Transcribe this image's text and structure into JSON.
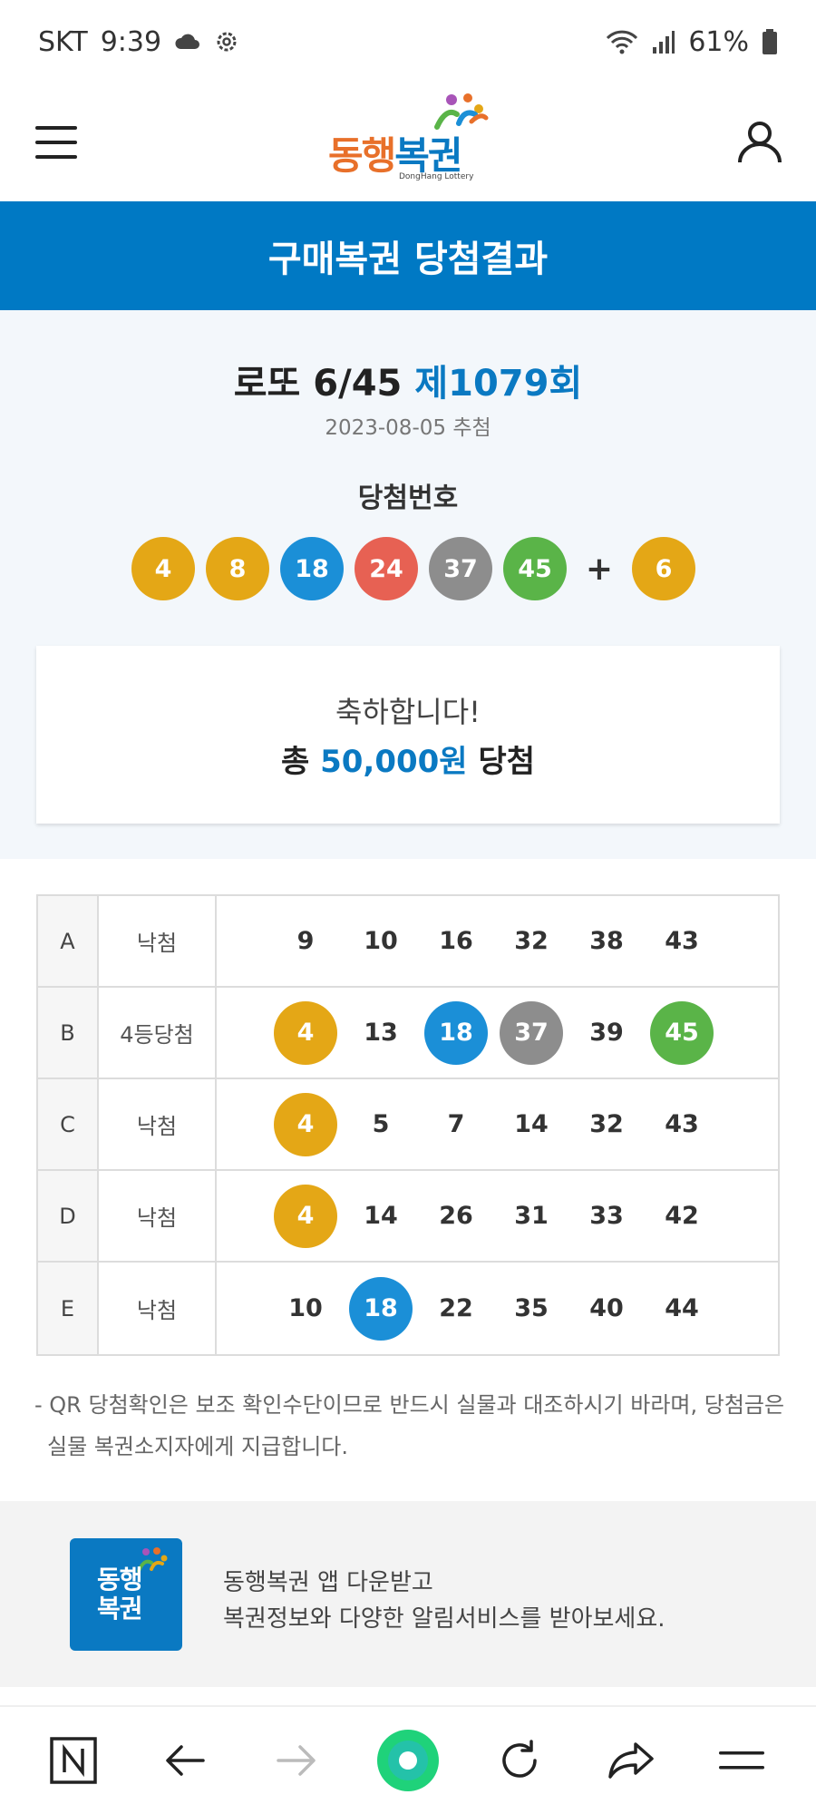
{
  "status_bar": {
    "carrier": "SKT",
    "time": "9:39",
    "battery": "61%",
    "icons": [
      "cloud-icon",
      "settings-icon",
      "wifi-icon",
      "signal-icon",
      "battery-icon"
    ]
  },
  "header": {
    "logo_text_part1": "동행",
    "logo_text_part2": "복권",
    "logo_sub": "DongHang Lottery",
    "menu_icon": "hamburger-menu-icon",
    "user_icon": "user-icon"
  },
  "banner": {
    "title": "구매복권 당첨결과"
  },
  "draw": {
    "game": "로또 6/45",
    "round": "제1079회",
    "date": "2023-08-05 추첨",
    "win_label": "당첨번호",
    "numbers": [
      {
        "value": "4",
        "color": "#e4a716"
      },
      {
        "value": "8",
        "color": "#e4a716"
      },
      {
        "value": "18",
        "color": "#1b8fd7"
      },
      {
        "value": "24",
        "color": "#e76153"
      },
      {
        "value": "37",
        "color": "#8d8d8d"
      },
      {
        "value": "45",
        "color": "#5ab448"
      }
    ],
    "plus": "+",
    "bonus": {
      "value": "6",
      "color": "#e4a716"
    }
  },
  "congrats": {
    "line1": "축하합니다!",
    "prefix": "총",
    "amount": "50,000원",
    "suffix": "당첨"
  },
  "tickets": [
    {
      "game": "A",
      "result": "낙첨",
      "numbers": [
        "9",
        "10",
        "16",
        "32",
        "38",
        "43"
      ],
      "hits": [
        null,
        null,
        null,
        null,
        null,
        null
      ]
    },
    {
      "game": "B",
      "result": "4등당첨",
      "numbers": [
        "4",
        "13",
        "18",
        "37",
        "39",
        "45"
      ],
      "hits": [
        "yellow",
        null,
        "blue",
        "gray",
        null,
        "green"
      ]
    },
    {
      "game": "C",
      "result": "낙첨",
      "numbers": [
        "4",
        "5",
        "7",
        "14",
        "32",
        "43"
      ],
      "hits": [
        "yellow",
        null,
        null,
        null,
        null,
        null
      ]
    },
    {
      "game": "D",
      "result": "낙첨",
      "numbers": [
        "4",
        "14",
        "26",
        "31",
        "33",
        "42"
      ],
      "hits": [
        "yellow",
        null,
        null,
        null,
        null,
        null
      ]
    },
    {
      "game": "E",
      "result": "낙첨",
      "numbers": [
        "10",
        "18",
        "22",
        "35",
        "40",
        "44"
      ],
      "hits": [
        null,
        "blue",
        null,
        null,
        null,
        null
      ]
    }
  ],
  "notice": {
    "line1": "- QR 당첨확인은 보조 확인수단이므로 반드시 실물과 대조하시기 바라며, 당첨금은",
    "line2": "실물 복권소지자에게 지급합니다."
  },
  "promo": {
    "logo_line1": "동행",
    "logo_line2": "복권",
    "line1": "동행복권 앱 다운받고",
    "line2": "복권정보와 다양한 알림서비스를 받아보세요."
  },
  "bottom_bar": {
    "icons": [
      "naver-home-icon",
      "back-arrow-icon",
      "forward-arrow-icon",
      "green-dot-icon",
      "refresh-icon",
      "share-icon",
      "menu-icon"
    ]
  },
  "colors": {
    "brand_blue": "#0079c4",
    "ball_yellow": "#e4a716",
    "ball_blue": "#1b8fd7",
    "ball_red": "#e76153",
    "ball_gray": "#8d8d8d",
    "ball_green": "#5ab448"
  }
}
